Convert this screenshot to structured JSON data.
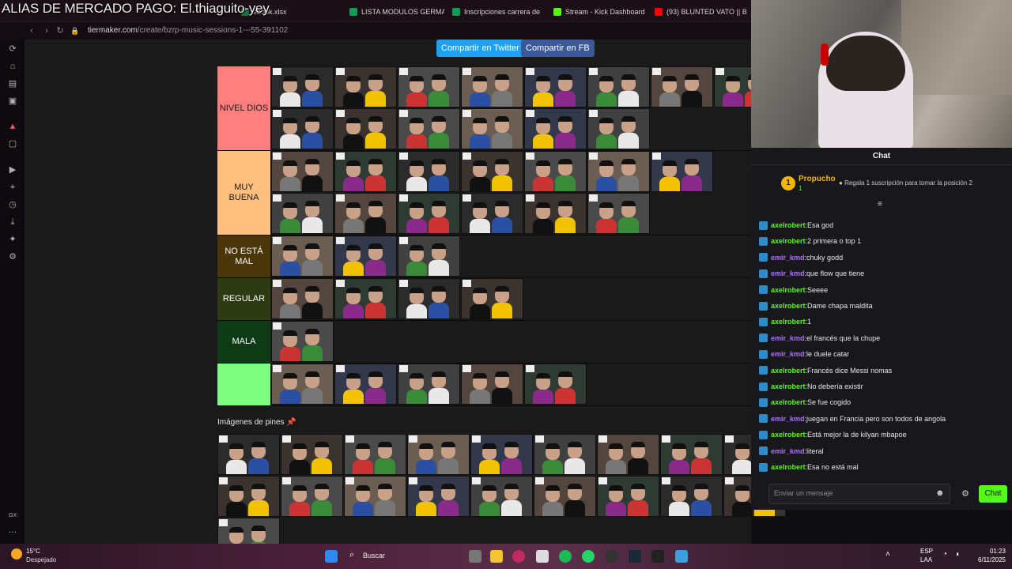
{
  "overlay": {
    "text": "ALIAS DE MERCADO PAGO: El.thiaguito-yey"
  },
  "browser": {
    "tabs": [
      {
        "label": "ebook.xlsx",
        "color": "#1d6f42"
      },
      {
        "label": "LISTA MODULOS GERMA",
        "color": "#0f9d58"
      },
      {
        "label": "Inscripciones carrera de",
        "color": "#0f9d58"
      },
      {
        "label": "Stream - Kick Dashboard",
        "color": "#53fc18"
      },
      {
        "label": "(93) BLUNTED VATO || B",
        "color": "#ff0000"
      }
    ],
    "url_host": "tiermaker.com",
    "url_path": "/create/bzrp-music-sessions-1---55-391102"
  },
  "share": {
    "twitter": "Compartir en Twitter",
    "fb": "Compartir en FB"
  },
  "tiers": [
    {
      "label": "NIVEL DIOS",
      "color": "#ff7f7f",
      "rows": [
        8,
        6
      ]
    },
    {
      "label": "MUY BUENA",
      "color": "#ffbf7f",
      "rows": [
        7,
        6
      ]
    },
    {
      "label": "NO ESTÁ MAL",
      "color": "#4a3608",
      "text_color": "#ffffff",
      "rows": [
        3
      ]
    },
    {
      "label": "REGULAR",
      "color": "#2d3a12",
      "text_color": "#ffffff",
      "rows": [
        4
      ]
    },
    {
      "label": "MALA",
      "color": "#0e3a16",
      "text_color": "#ffffff",
      "rows": [
        1
      ]
    },
    {
      "label": "",
      "color": "#7fff7f",
      "rows": [
        5
      ]
    }
  ],
  "pines": {
    "title": "Imágenes de pines",
    "rows": [
      9,
      9,
      1
    ]
  },
  "chat": {
    "title": "Chat",
    "top_user": "Propucho",
    "top_rank": "1",
    "top_count": "1",
    "gift_text": "Regala 1 suscripción para tomar la posición 2",
    "messages": [
      {
        "user": "axelrobert",
        "text": "Esa god",
        "color": "#53fc18"
      },
      {
        "user": "axelrobert",
        "text": "2 primera o top 1",
        "color": "#53fc18"
      },
      {
        "user": "emir_kmd",
        "text": "chuky godd",
        "color": "#b070ff"
      },
      {
        "user": "emir_kmd",
        "text": "que flow que tiene",
        "color": "#b070ff"
      },
      {
        "user": "axelrobert",
        "text": "Seeee",
        "color": "#53fc18"
      },
      {
        "user": "axelrobert",
        "text": "Dame chapa maldita",
        "color": "#53fc18"
      },
      {
        "user": "axelrobert",
        "text": "1",
        "color": "#53fc18"
      },
      {
        "user": "emir_kmd",
        "text": "el francés que la chupe",
        "color": "#b070ff"
      },
      {
        "user": "emir_kmd",
        "text": "le duele catar",
        "color": "#b070ff"
      },
      {
        "user": "axelrobert",
        "text": "Francés dice Messi nomas",
        "color": "#53fc18"
      },
      {
        "user": "axelrobert",
        "text": "No debería existir",
        "color": "#53fc18"
      },
      {
        "user": "axelrobert",
        "text": "Se fue cogido",
        "color": "#53fc18"
      },
      {
        "user": "emir_kmd",
        "text": "juegan en Francia pero son todos de angola",
        "color": "#b070ff"
      },
      {
        "user": "axelrobert",
        "text": "Está mejor la de kilyan mbapoe",
        "color": "#53fc18"
      },
      {
        "user": "emir_kmd",
        "text": "literal",
        "color": "#b070ff"
      },
      {
        "user": "axelrobert",
        "text": "Esa no está mal",
        "color": "#53fc18"
      }
    ],
    "input_placeholder": "Enviar un mensaje",
    "send_label": "Chat"
  },
  "taskbar": {
    "temp": "15°C",
    "weather": "Despejado",
    "search": "Buscar",
    "lang1": "ESP",
    "lang2": "LAA",
    "time": "01:23",
    "date": "6/11/2025"
  }
}
